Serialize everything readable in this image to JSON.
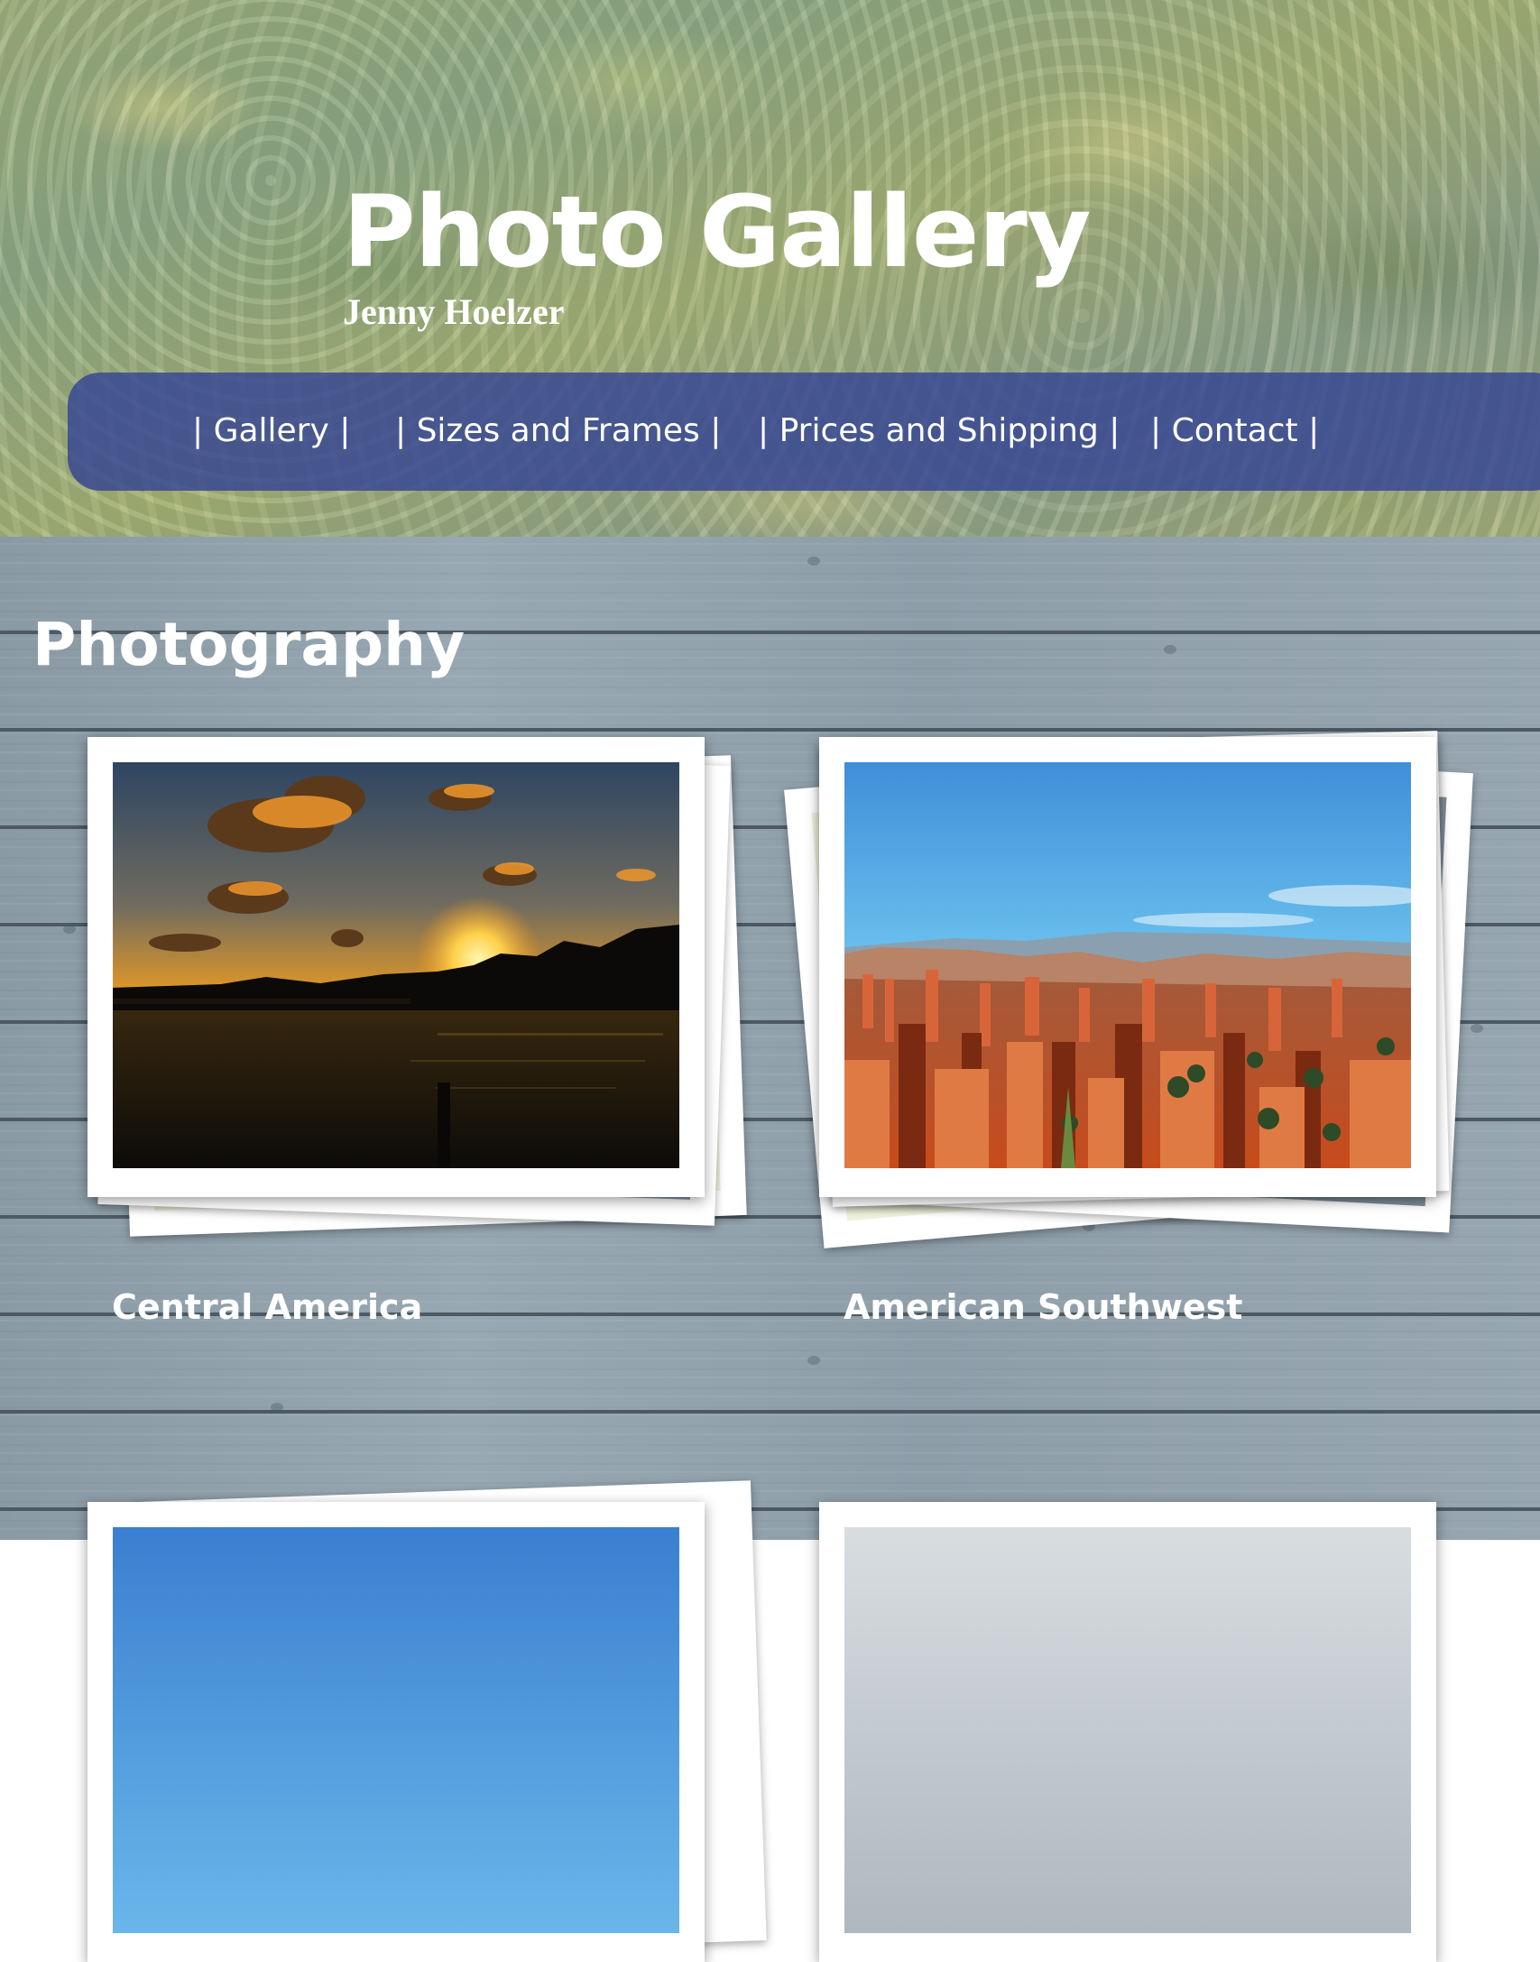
{
  "header": {
    "title": "Photo Gallery",
    "author": "Jenny Hoelzer"
  },
  "nav": {
    "items": [
      {
        "label": "| Gallery |"
      },
      {
        "label": "| Sizes and Frames |"
      },
      {
        "label": "| Prices and Shipping |"
      },
      {
        "label": "| Contact |"
      }
    ]
  },
  "main": {
    "heading": "Photography",
    "albums": [
      {
        "title": "Central America",
        "photo": "sunset-over-water"
      },
      {
        "title": "American Southwest",
        "photo": "red-rock-canyon"
      }
    ]
  },
  "colors": {
    "nav_background": "#344494",
    "text": "#ffffff"
  }
}
